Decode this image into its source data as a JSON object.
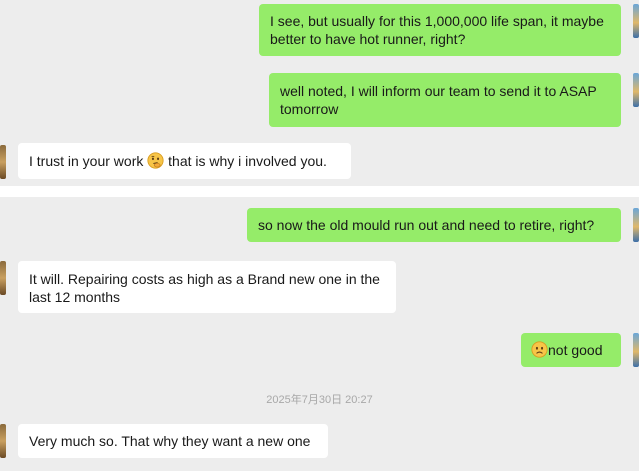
{
  "messages": {
    "m1": "I see, but usually for this 1,000,000 life span, it maybe better to have hot runner, right?",
    "m2": "well noted, I will inform our team to send it to ASAP tomorrow",
    "m3_before": "I trust in your work ",
    "m3_after": " that is why i involved you.",
    "m4": "so now the old mould run out and need to retire, right?",
    "m5": "It will. Repairing costs as high as a Brand new one in the last 12 months",
    "m6": "not good",
    "m7": "Very much so. That why they want a new one"
  },
  "timestamp": "2025年7月30日 20:27",
  "icons": {
    "m3_emoji": "thinking-face-icon",
    "m6_emoji": "frowning-face-icon",
    "contact_avatar": "contact-avatar",
    "user_avatar": "user-avatar"
  },
  "colors": {
    "outgoing_bubble": "#95ec69",
    "incoming_bubble": "#ffffff",
    "chat_background": "#ededed",
    "timestamp_text": "#a8a8a8"
  }
}
